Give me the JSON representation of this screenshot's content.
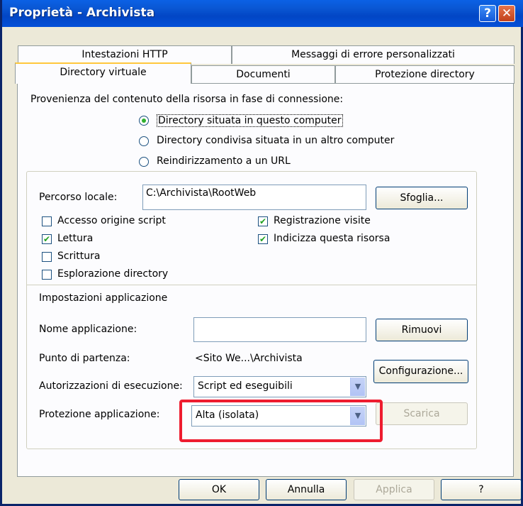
{
  "window": {
    "title": "Proprietà - Archivista"
  },
  "tabs": {
    "row1": [
      "Intestazioni HTTP",
      "Messaggi di errore personalizzati"
    ],
    "row2": [
      "Directory virtuale",
      "Documenti",
      "Protezione directory"
    ],
    "active": "Directory virtuale"
  },
  "source": {
    "heading": "Provenienza del contenuto della risorsa in fase di connessione:",
    "options": [
      {
        "label": "Directory situata in questo computer",
        "selected": true
      },
      {
        "label": "Directory condivisa situata in un altro computer",
        "selected": false
      },
      {
        "label": "Reindirizzamento a un URL",
        "selected": false
      }
    ]
  },
  "local_path": {
    "label": "Percorso locale:",
    "value": "C:\\Archivista\\RootWeb",
    "browse_label": "Sfoglia..."
  },
  "permissions": [
    {
      "label": "Accesso origine script",
      "checked": false
    },
    {
      "label": "Lettura",
      "checked": true
    },
    {
      "label": "Scrittura",
      "checked": false
    },
    {
      "label": "Esplorazione directory",
      "checked": false
    },
    {
      "label": "Registrazione visite",
      "checked": true
    },
    {
      "label": "Indicizza questa risorsa",
      "checked": true
    }
  ],
  "app": {
    "heading": "Impostazioni applicazione",
    "name_label": "Nome applicazione:",
    "name_value": "",
    "remove_label": "Rimuovi",
    "start_label": "Punto di partenza:",
    "start_value": "<Sito We...\\Archivista",
    "config_label": "Configurazione...",
    "exec_label": "Autorizzazioni di esecuzione:",
    "exec_value": "Script ed eseguibili",
    "protection_label": "Protezione applicazione:",
    "protection_value": "Alta (isolata)",
    "unload_label": "Scarica"
  },
  "footer": {
    "ok": "OK",
    "cancel": "Annulla",
    "apply": "Applica",
    "help": "?"
  },
  "icons": {
    "check": "✔",
    "dropdown": "▼"
  },
  "colors": {
    "highlight": "#ee1c2f",
    "titlebar": "#0450d8"
  }
}
